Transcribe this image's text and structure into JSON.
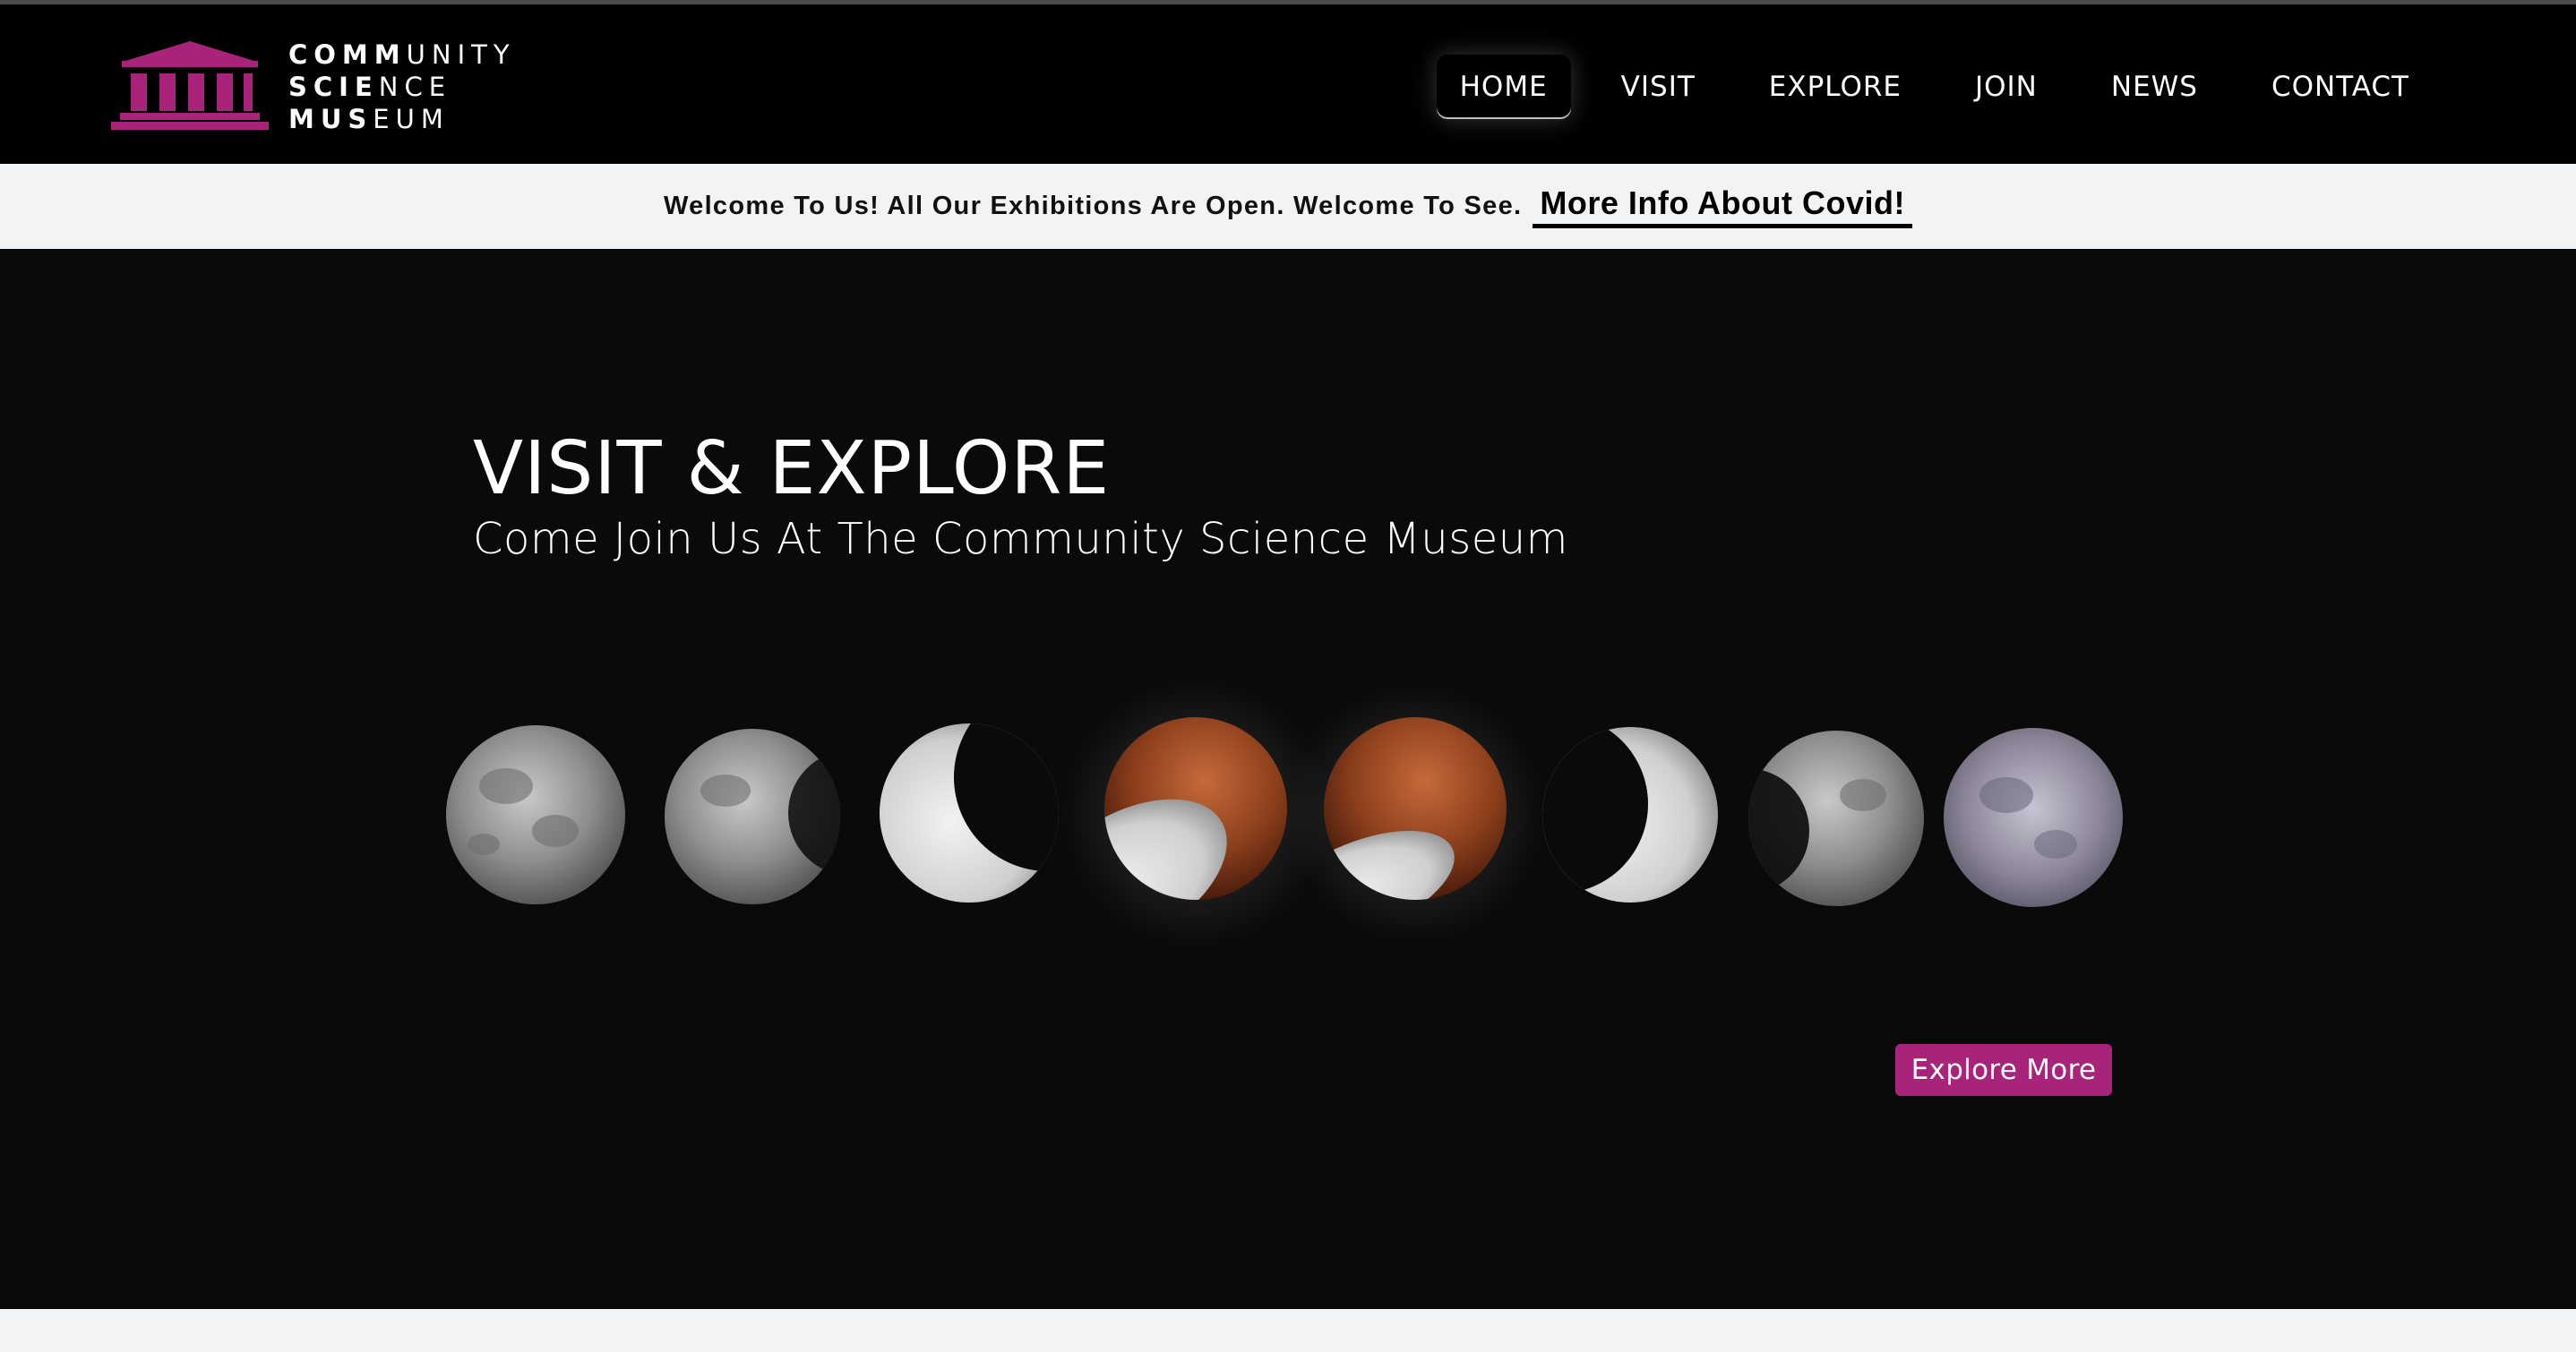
{
  "brand": {
    "lines": [
      {
        "bold": "COMM",
        "rest": "UNITY"
      },
      {
        "bold": "SCIE",
        "rest": "NCE"
      },
      {
        "bold": "MUS",
        "rest": "EUM"
      }
    ],
    "logo_icon": "museum-building-icon",
    "accent_color": "#a8237a"
  },
  "nav": {
    "items": [
      {
        "label": "HOME",
        "active": true
      },
      {
        "label": "VISIT",
        "active": false
      },
      {
        "label": "EXPLORE",
        "active": false
      },
      {
        "label": "JOIN",
        "active": false
      },
      {
        "label": "NEWS",
        "active": false
      },
      {
        "label": "CONTACT",
        "active": false
      }
    ]
  },
  "announcement": {
    "text": "Welcome To Us! All Our Exhibitions Are Open. Welcome To See.",
    "link_label": "More Info About Covid!"
  },
  "hero": {
    "title": "VISIT & EXPLORE",
    "subtitle": "Come Join Us At The Community Science Museum",
    "image_subject": "lunar-eclipse-phases",
    "cta_label": "Explore More"
  },
  "colors": {
    "header_bg": "#000000",
    "announce_bg": "#f2f3f5",
    "hero_bg": "#0a0a0a",
    "cta_bg": "#a8237a",
    "moon_copper": "#b0532a",
    "moon_gray": "#9a9a9a"
  }
}
